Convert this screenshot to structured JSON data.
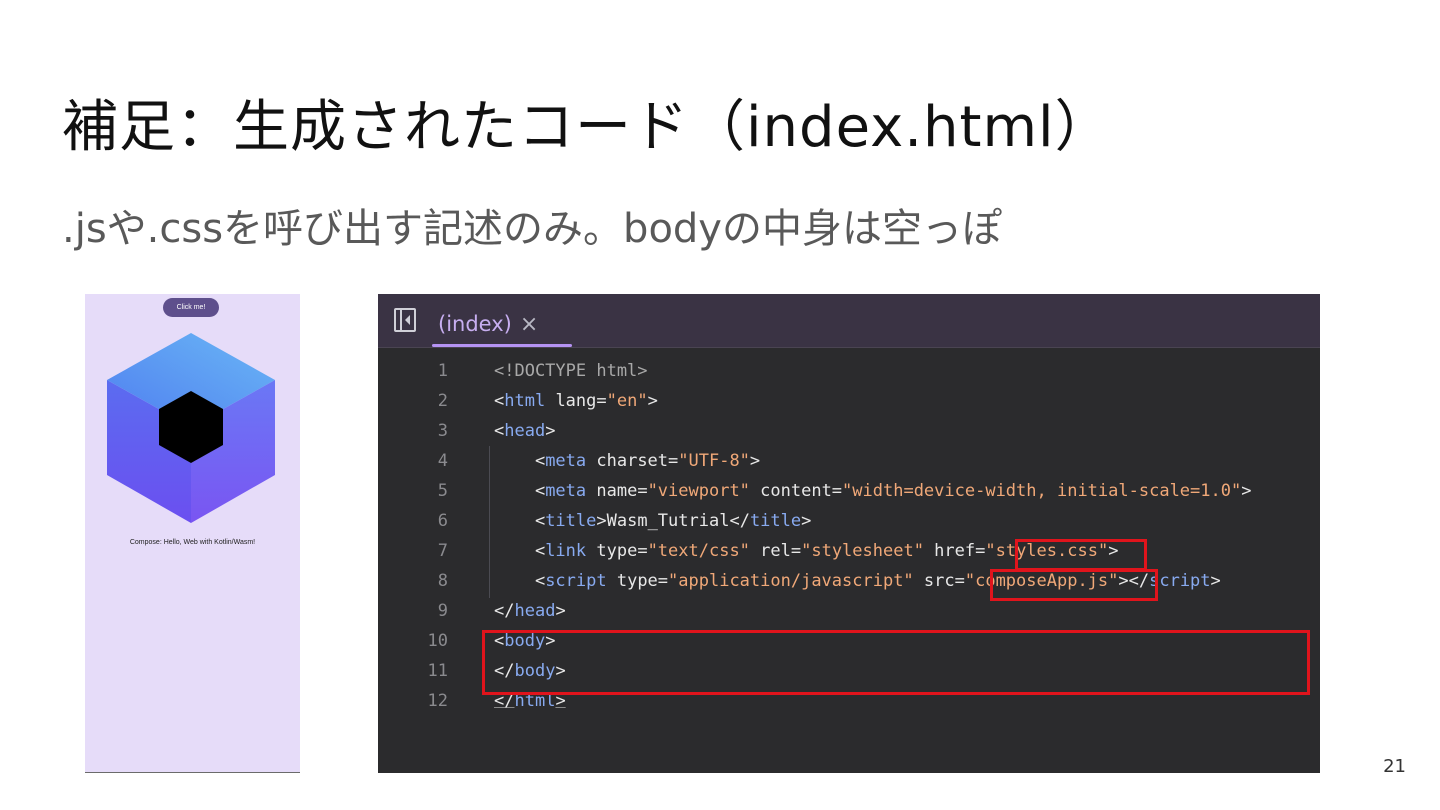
{
  "slide": {
    "title": "補足：生成されたコード（index.html）",
    "subtitle": ".jsや.cssを呼び出す記述のみ。bodyの中身は空っぽ",
    "page_number": "21"
  },
  "app_preview": {
    "button_label": "Click me!",
    "greeting": "Compose: Hello, Web with Kotlin/Wasm!",
    "logo_icon": "compose-multiplatform-logo-icon",
    "colors": {
      "background": "#e6dcf9",
      "button": "#5e4f8c"
    }
  },
  "editor": {
    "tab_label": "(index)",
    "tab_close": "×",
    "panel_icon": "sidebar-toggle-icon",
    "colors": {
      "background": "#2b2b2d",
      "tabbar": "#3a3344",
      "accent": "#b593f3",
      "highlight": "#e0141c"
    },
    "lines": [
      {
        "n": "1",
        "tokens": [
          {
            "t": "<!DOCTYPE html>",
            "c": "doc"
          }
        ]
      },
      {
        "n": "2",
        "tokens": [
          {
            "t": "<",
            "c": "tag"
          },
          {
            "t": "html",
            "c": "name"
          },
          {
            "t": " lang=",
            "c": "attr"
          },
          {
            "t": "\"en\"",
            "c": "val"
          },
          {
            "t": ">",
            "c": "tag"
          }
        ]
      },
      {
        "n": "3",
        "tokens": [
          {
            "t": "<",
            "c": "tag"
          },
          {
            "t": "head",
            "c": "name"
          },
          {
            "t": ">",
            "c": "tag"
          }
        ]
      },
      {
        "n": "4",
        "tokens": [
          {
            "t": "    <",
            "c": "tag"
          },
          {
            "t": "meta",
            "c": "name"
          },
          {
            "t": " charset=",
            "c": "attr"
          },
          {
            "t": "\"UTF-8\"",
            "c": "val"
          },
          {
            "t": ">",
            "c": "tag"
          }
        ]
      },
      {
        "n": "5",
        "tokens": [
          {
            "t": "    <",
            "c": "tag"
          },
          {
            "t": "meta",
            "c": "name"
          },
          {
            "t": " name=",
            "c": "attr"
          },
          {
            "t": "\"viewport\"",
            "c": "val"
          },
          {
            "t": " content=",
            "c": "attr"
          },
          {
            "t": "\"width=device-width, initial-scale=1.0\"",
            "c": "val"
          },
          {
            "t": ">",
            "c": "tag"
          }
        ]
      },
      {
        "n": "6",
        "tokens": [
          {
            "t": "    <",
            "c": "tag"
          },
          {
            "t": "title",
            "c": "name"
          },
          {
            "t": ">",
            "c": "tag"
          },
          {
            "t": "Wasm_Tutrial",
            "c": "txt"
          },
          {
            "t": "</",
            "c": "tag"
          },
          {
            "t": "title",
            "c": "name"
          },
          {
            "t": ">",
            "c": "tag"
          }
        ]
      },
      {
        "n": "7",
        "tokens": [
          {
            "t": "    <",
            "c": "tag"
          },
          {
            "t": "link",
            "c": "name"
          },
          {
            "t": " type=",
            "c": "attr"
          },
          {
            "t": "\"text/css\"",
            "c": "val"
          },
          {
            "t": " rel=",
            "c": "attr"
          },
          {
            "t": "\"stylesheet\"",
            "c": "val"
          },
          {
            "t": " href=",
            "c": "attr"
          },
          {
            "t": "\"styles.css\"",
            "c": "val"
          },
          {
            "t": ">",
            "c": "tag"
          }
        ]
      },
      {
        "n": "8",
        "tokens": [
          {
            "t": "    <",
            "c": "tag"
          },
          {
            "t": "script",
            "c": "name"
          },
          {
            "t": " type=",
            "c": "attr"
          },
          {
            "t": "\"application/javascript\"",
            "c": "val"
          },
          {
            "t": " src=",
            "c": "attr"
          },
          {
            "t": "\"composeApp.js\"",
            "c": "val"
          },
          {
            "t": "></",
            "c": "tag"
          },
          {
            "t": "script",
            "c": "name"
          },
          {
            "t": ">",
            "c": "tag"
          }
        ]
      },
      {
        "n": "9",
        "tokens": [
          {
            "t": "</",
            "c": "tag"
          },
          {
            "t": "head",
            "c": "name"
          },
          {
            "t": ">",
            "c": "tag"
          }
        ]
      },
      {
        "n": "10",
        "tokens": [
          {
            "t": "<",
            "c": "tag"
          },
          {
            "t": "body",
            "c": "name"
          },
          {
            "t": ">",
            "c": "tag"
          }
        ]
      },
      {
        "n": "11",
        "tokens": [
          {
            "t": "</",
            "c": "tag"
          },
          {
            "t": "body",
            "c": "name"
          },
          {
            "t": ">",
            "c": "tag"
          }
        ]
      },
      {
        "n": "12",
        "tokens": [
          {
            "t": "</",
            "c": "tag ul"
          },
          {
            "t": "html",
            "c": "name"
          },
          {
            "t": ">",
            "c": "tag ul"
          }
        ]
      }
    ]
  }
}
